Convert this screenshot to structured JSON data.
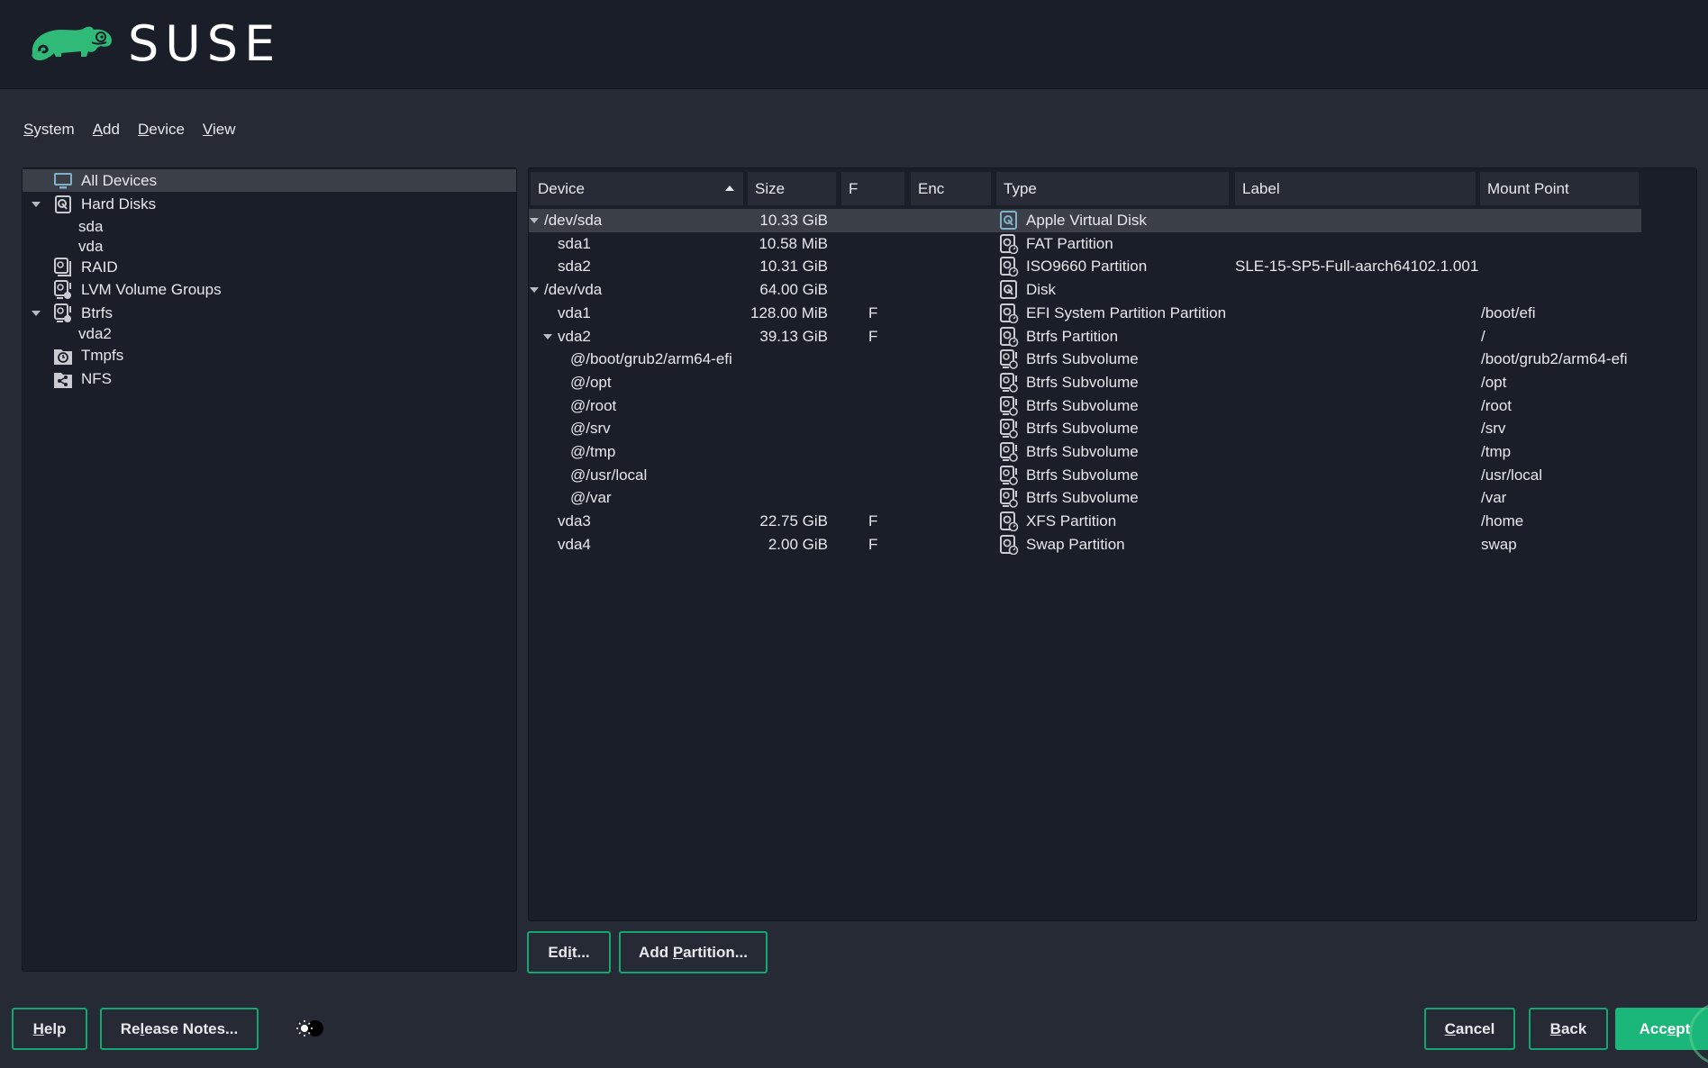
{
  "brand": {
    "name": "SUSE",
    "color": "#30ba78",
    "icon": "chameleon-logo-icon"
  },
  "menu": [
    {
      "label": "System",
      "mnemonic": "S"
    },
    {
      "label": "Add",
      "mnemonic": "A"
    },
    {
      "label": "Device",
      "mnemonic": "D"
    },
    {
      "label": "View",
      "mnemonic": "V"
    }
  ],
  "tree": {
    "items": [
      {
        "label": "All Devices",
        "icon": "monitor-icon",
        "selected": true,
        "expandable": false,
        "level": 0
      },
      {
        "label": "Hard Disks",
        "icon": "hard-disk-icon",
        "expandable": true,
        "expanded": true,
        "level": 0
      },
      {
        "label": "sda",
        "level": 1
      },
      {
        "label": "vda",
        "level": 1
      },
      {
        "label": "RAID",
        "icon": "raid-icon",
        "level": 0
      },
      {
        "label": "LVM Volume Groups",
        "icon": "lvm-icon",
        "level": 0
      },
      {
        "label": "Btrfs",
        "icon": "btrfs-icon",
        "expandable": true,
        "expanded": true,
        "level": 0
      },
      {
        "label": "vda2",
        "level": 1
      },
      {
        "label": "Tmpfs",
        "icon": "tmpfs-clock-icon",
        "level": 0
      },
      {
        "label": "NFS",
        "icon": "nfs-share-icon",
        "level": 0
      }
    ]
  },
  "table": {
    "columns": [
      "Device",
      "Size",
      "F",
      "Enc",
      "Type",
      "Label",
      "Mount Point"
    ],
    "sort_column": "Device",
    "sort_direction": "ascending",
    "rows": [
      {
        "device": "/dev/sda",
        "size": "10.33 GiB",
        "f": "",
        "enc": "",
        "type": "Apple Virtual Disk",
        "label": "",
        "mount": "",
        "level": 0,
        "expanded": true,
        "selected": true,
        "icon": "disk-icon"
      },
      {
        "device": "sda1",
        "size": "10.58 MiB",
        "f": "",
        "enc": "",
        "type": "FAT Partition",
        "label": "",
        "mount": "",
        "level": 1,
        "icon": "partition-icon"
      },
      {
        "device": "sda2",
        "size": "10.31 GiB",
        "f": "",
        "enc": "",
        "type": "ISO9660 Partition",
        "label": "SLE-15-SP5-Full-aarch64102.1.001",
        "mount": "",
        "level": 1,
        "icon": "partition-icon"
      },
      {
        "device": "/dev/vda",
        "size": "64.00 GiB",
        "f": "",
        "enc": "",
        "type": "Disk",
        "label": "",
        "mount": "",
        "level": 0,
        "expanded": true,
        "icon": "disk-icon"
      },
      {
        "device": "vda1",
        "size": "128.00 MiB",
        "f": "F",
        "enc": "",
        "type": "EFI System Partition Partition",
        "label": "",
        "mount": "/boot/efi",
        "level": 1,
        "icon": "partition-icon"
      },
      {
        "device": "vda2",
        "size": "39.13 GiB",
        "f": "F",
        "enc": "",
        "type": "Btrfs Partition",
        "label": "",
        "mount": "/",
        "level": 1,
        "expanded": true,
        "icon": "partition-icon"
      },
      {
        "device": "@/boot/grub2/arm64-efi",
        "size": "",
        "f": "",
        "enc": "",
        "type": "Btrfs Subvolume",
        "label": "",
        "mount": "/boot/grub2/arm64-efi",
        "level": 2,
        "icon": "subvolume-icon"
      },
      {
        "device": "@/opt",
        "size": "",
        "f": "",
        "enc": "",
        "type": "Btrfs Subvolume",
        "label": "",
        "mount": "/opt",
        "level": 2,
        "icon": "subvolume-icon"
      },
      {
        "device": "@/root",
        "size": "",
        "f": "",
        "enc": "",
        "type": "Btrfs Subvolume",
        "label": "",
        "mount": "/root",
        "level": 2,
        "icon": "subvolume-icon"
      },
      {
        "device": "@/srv",
        "size": "",
        "f": "",
        "enc": "",
        "type": "Btrfs Subvolume",
        "label": "",
        "mount": "/srv",
        "level": 2,
        "icon": "subvolume-icon"
      },
      {
        "device": "@/tmp",
        "size": "",
        "f": "",
        "enc": "",
        "type": "Btrfs Subvolume",
        "label": "",
        "mount": "/tmp",
        "level": 2,
        "icon": "subvolume-icon"
      },
      {
        "device": "@/usr/local",
        "size": "",
        "f": "",
        "enc": "",
        "type": "Btrfs Subvolume",
        "label": "",
        "mount": "/usr/local",
        "level": 2,
        "icon": "subvolume-icon"
      },
      {
        "device": "@/var",
        "size": "",
        "f": "",
        "enc": "",
        "type": "Btrfs Subvolume",
        "label": "",
        "mount": "/var",
        "level": 2,
        "icon": "subvolume-icon"
      },
      {
        "device": "vda3",
        "size": "22.75 GiB",
        "f": "F",
        "enc": "",
        "type": "XFS Partition",
        "label": "",
        "mount": "/home",
        "level": 1,
        "icon": "partition-icon"
      },
      {
        "device": "vda4",
        "size": "2.00 GiB",
        "f": "F",
        "enc": "",
        "type": "Swap Partition",
        "label": "",
        "mount": "swap",
        "level": 1,
        "icon": "partition-icon"
      }
    ]
  },
  "actions": {
    "edit": {
      "label": "Edit...",
      "mnemonic_index": 2
    },
    "add_partition": {
      "label": "Add Partition...",
      "mnemonic_index": 4
    }
  },
  "footer": {
    "help": {
      "label": "Help",
      "mnemonic_index": 0
    },
    "release_notes": {
      "label": "Release Notes...",
      "mnemonic_index": 2
    },
    "theme_toggle": "theme-toggle-icon",
    "cancel": {
      "label": "Cancel",
      "mnemonic_index": 0
    },
    "back": {
      "label": "Back",
      "mnemonic_index": 0
    },
    "accept": {
      "label": "Accept",
      "mnemonic_index": 3
    }
  },
  "colors": {
    "accent": "#30ba78",
    "button_border": "#13a670",
    "primary_button": "#1bb77a",
    "background": "#262a35",
    "panel": "#1a1e28",
    "selection": "#3b3f48",
    "icon_highlight": "#7fb2c9"
  }
}
